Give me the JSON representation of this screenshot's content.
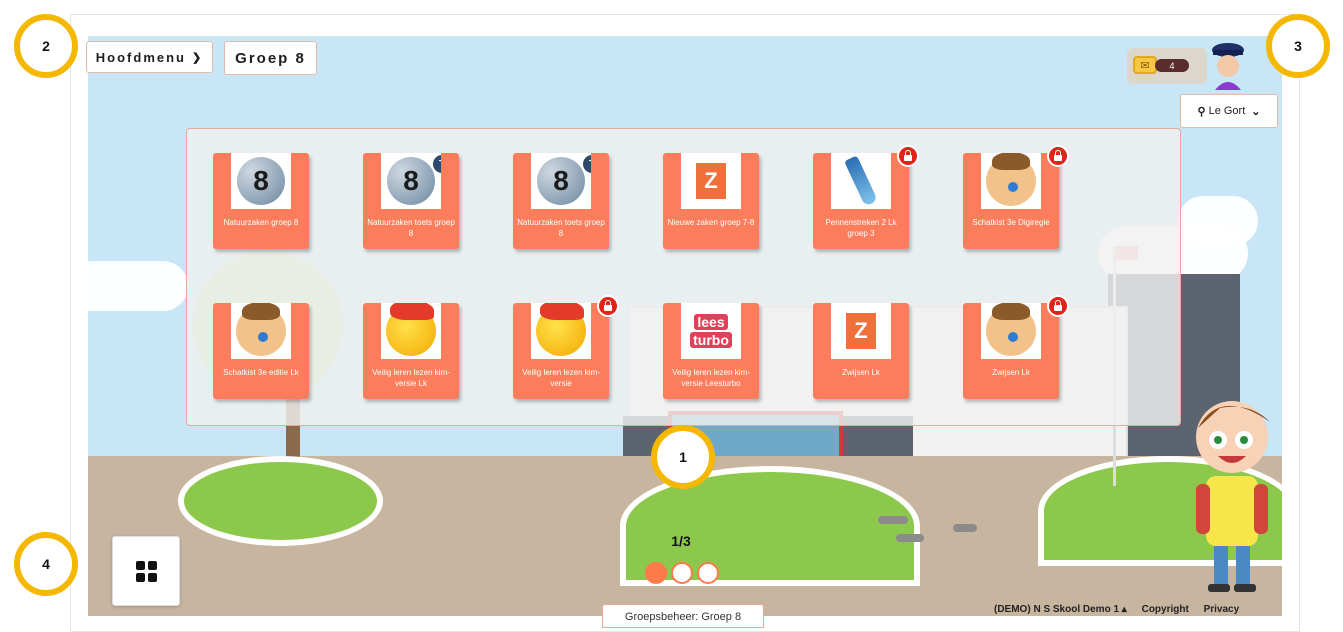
{
  "header": {
    "main_menu_label": "Hoofdmenu",
    "group_label": "Groep 8"
  },
  "user": {
    "coins": "4",
    "search_label": "Le Gort"
  },
  "tiles": [
    {
      "label": "Natuurzaken groep 8",
      "thumb": "8",
      "kind": "globe",
      "locked": false,
      "test": false
    },
    {
      "label": "Natuurzaken toets groep 8",
      "thumb": "8",
      "kind": "globe",
      "locked": false,
      "test": true,
      "badge": "T"
    },
    {
      "label": "Natuurzaken toets groep 8",
      "thumb": "8",
      "kind": "globe",
      "locked": false,
      "test": true,
      "badge": "T"
    },
    {
      "label": "Nieuwe zaken groep 7-8",
      "thumb": "Z",
      "kind": "z",
      "locked": false,
      "test": false
    },
    {
      "label": "Pennenstreken 2 Lk groep 3",
      "thumb": "",
      "kind": "pen",
      "locked": true,
      "test": false
    },
    {
      "label": "Schatkist 3e Digiregie",
      "thumb": "",
      "kind": "face",
      "locked": true,
      "test": false
    },
    {
      "label": "Schatkist 3e editie Lk",
      "thumb": "",
      "kind": "face",
      "locked": false,
      "test": false
    },
    {
      "label": "Veilig leren lezen kim-versie Lk",
      "thumb": "",
      "kind": "ball",
      "locked": false,
      "test": false
    },
    {
      "label": "Veilig leren lezen kim-versie",
      "thumb": "",
      "kind": "ball",
      "locked": true,
      "test": false
    },
    {
      "label": "Veilig leren lezen kim-versie Leesturbo",
      "thumb": "",
      "kind": "lees",
      "locked": false,
      "test": false,
      "logo_text": [
        "lees",
        "turbo"
      ]
    },
    {
      "label": "Zwijsen Lk",
      "thumb": "Z",
      "kind": "z",
      "locked": false,
      "test": false
    },
    {
      "label": "Zwijsen Lk",
      "thumb": "",
      "kind": "face",
      "locked": true,
      "test": false
    }
  ],
  "pager": {
    "label": "1/3",
    "current": 1,
    "total": 3
  },
  "bottom": {
    "group_admin_label": "Groepsbeheer: Groep 8",
    "school_label": "(DEMO) N S Skool Demo 1 ▴",
    "copyright_label": "Copyright",
    "privacy_label": "Privacy"
  },
  "callouts": [
    "1",
    "2",
    "3",
    "4"
  ],
  "colors": {
    "tile": "#fb7d5c",
    "accent": "#ff7a4a",
    "callout_ring": "#f5b800",
    "lock": "#e2231a",
    "sky": "#c8e6f5"
  }
}
